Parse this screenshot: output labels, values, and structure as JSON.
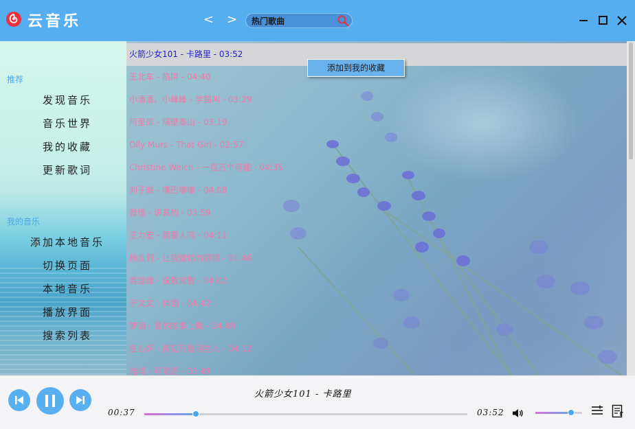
{
  "app": {
    "title": "云音乐",
    "colors": {
      "titlebar": "#55aef0",
      "accent": "#4aa6ee",
      "song_text": "#f07aa8",
      "selected_text": "#1e1ec8"
    }
  },
  "header": {
    "back_label": "<",
    "forward_label": ">",
    "search": {
      "value": "热门歌曲",
      "placeholder": ""
    },
    "icons": [
      "logo-icon",
      "search-icon",
      "minimize-icon",
      "maximize-icon",
      "close-icon"
    ]
  },
  "sidebar": {
    "sections": [
      {
        "label": "推荐",
        "items": [
          "发现音乐",
          "音乐世界",
          "我的收藏",
          "更新歌词"
        ]
      },
      {
        "label": "我的音乐",
        "items": [
          "添加本地音乐",
          "切换页面",
          "本地音乐",
          "播放界面",
          "搜索列表"
        ]
      }
    ]
  },
  "songs": [
    "火箭少女101 - 卡路里 - 03:52",
    "王北车 - 陷阱 - 04:40",
    "小潘潘、小峰峰 - 学猫叫 - 03:29",
    "阿里郎 - 隔壁泰山 - 03:19",
    "Olly Murs - That Girl - 02:57",
    "Christine Welch - 一百万个可能 - 04:35",
    "刘子璇 - 嘴巴嘟嘟 - 04:08",
    "曾惜 - 讲真的 - 03:59",
    "王力宏 - 需要人陪 - 04:11",
    "杨凯莉 - 让我做你的眼睛 - 01:46",
    "袁娅维 - 说散就散 - 04:02",
    "于文文 - 体面 - 04:42",
    "梦涵 - 爱的故事上集 - 04:49",
    "庄心妍 - 再见只是陌生人 - 04:12",
    "浩晴 - 可能否 - 03:49"
  ],
  "selected_song_index": 0,
  "context_menu": {
    "item": "添加到我的收藏"
  },
  "player": {
    "now_playing": "火箭少女101 - 卡路里",
    "current_time": "00:37",
    "total_time": "03:52",
    "progress_fraction": 0.16,
    "volume_fraction": 0.77,
    "icons": [
      "previous-icon",
      "pause-icon",
      "next-icon",
      "volume-icon",
      "playlist-icon",
      "lyrics-icon"
    ]
  }
}
